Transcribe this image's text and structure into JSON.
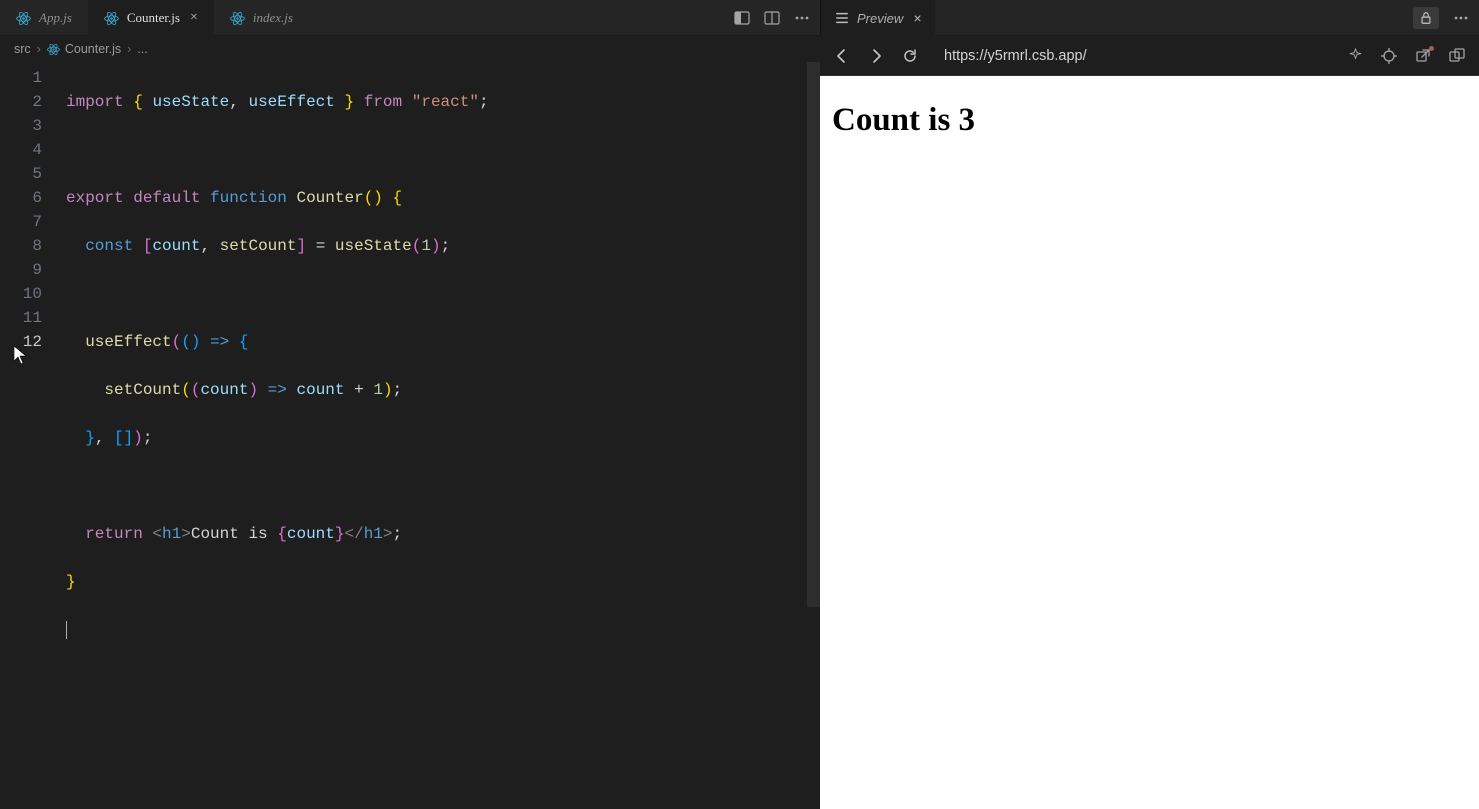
{
  "tabs": [
    {
      "label": "App.js",
      "active": false,
      "modified": false
    },
    {
      "label": "Counter.js",
      "active": true,
      "modified": false
    },
    {
      "label": "index.js",
      "active": false,
      "modified": false
    }
  ],
  "previewTab": {
    "label": "Preview",
    "active": true
  },
  "breadcrumbs": {
    "folder": "src",
    "file": "Counter.js",
    "tail": "..."
  },
  "gutter": [
    "1",
    "2",
    "3",
    "4",
    "5",
    "6",
    "7",
    "8",
    "9",
    "10",
    "11",
    "12"
  ],
  "code": {
    "l1": {
      "a": "import",
      "b": "{",
      "c": "useState",
      "d": ",",
      "e": "useEffect",
      "f": "}",
      "g": "from",
      "h": "\"react\"",
      "i": ";"
    },
    "l3": {
      "a": "export",
      "b": "default",
      "c": "function",
      "d": "Counter",
      "e": "()",
      "f": "{"
    },
    "l4": {
      "a": "const",
      "b": "[",
      "c": "count",
      "d": ",",
      "e": "setCount",
      "f": "]",
      "g": "=",
      "h": "useState",
      "i": "(",
      "j": "1",
      "k": ")",
      "l": ";"
    },
    "l6": {
      "a": "useEffect",
      "b": "(",
      "c": "()",
      "d": "=>",
      "e": "{"
    },
    "l7": {
      "a": "setCount",
      "b": "(",
      "c": "(",
      "d": "count",
      "e": ")",
      "f": "=>",
      "g": "count",
      "h": "+",
      "i": "1",
      "j": ")",
      "k": ";"
    },
    "l8": {
      "a": "}",
      "b": ",",
      "c": "[",
      "d": "]",
      "e": ")",
      "f": ";"
    },
    "l10": {
      "a": "return",
      "b": "<",
      "c": "h1",
      "d": ">",
      "e": "Count is ",
      "f": "{",
      "g": "count",
      "h": "}",
      "i": "</",
      "j": "h1",
      "k": ">",
      "l": ";"
    },
    "l11": {
      "a": "}"
    }
  },
  "preview": {
    "url": "https://y5rmrl.csb.app/",
    "heading": "Count is 3"
  }
}
